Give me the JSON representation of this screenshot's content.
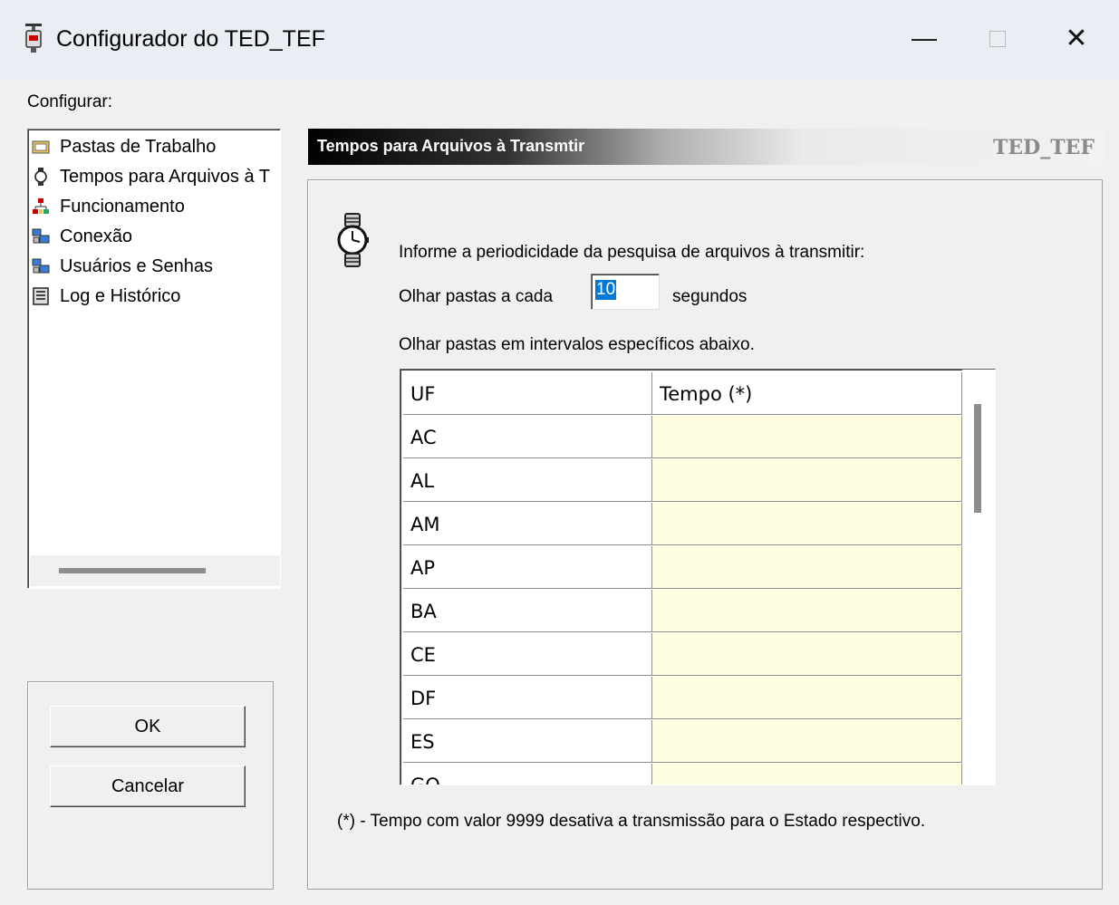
{
  "window": {
    "title": "Configurador do TED_TEF",
    "minimize": "—",
    "close": "✕"
  },
  "configure_label": "Configurar:",
  "tree": {
    "items": [
      {
        "label": "Pastas de Trabalho",
        "icon": "folder-icon"
      },
      {
        "label": "Tempos para Arquivos à T",
        "icon": "watch-icon"
      },
      {
        "label": "Funcionamento",
        "icon": "network-icon"
      },
      {
        "label": "Conexão",
        "icon": "computers-icon"
      },
      {
        "label": "Usuários e Senhas",
        "icon": "computers-icon"
      },
      {
        "label": "Log e Histórico",
        "icon": "log-icon"
      }
    ]
  },
  "buttons": {
    "ok": "OK",
    "cancel": "Cancelar"
  },
  "header": {
    "title": "Tempos para Arquivos à Transmtir",
    "app": "TED_TEF"
  },
  "panel": {
    "instruction": "Informe a periodicidade da pesquisa de arquivos à transmitir:",
    "interval_prefix": "Olhar pastas a cada",
    "interval_value": "10",
    "interval_suffix": "segundos",
    "specific_label": "Olhar pastas em intervalos específicos abaixo.",
    "footnote": "(*) - Tempo com valor 9999 desativa a transmissão para o Estado respectivo."
  },
  "grid": {
    "columns": [
      "UF",
      "Tempo (*)"
    ],
    "rows": [
      {
        "uf": "AC",
        "tempo": ""
      },
      {
        "uf": "AL",
        "tempo": ""
      },
      {
        "uf": "AM",
        "tempo": ""
      },
      {
        "uf": "AP",
        "tempo": ""
      },
      {
        "uf": "BA",
        "tempo": ""
      },
      {
        "uf": "CE",
        "tempo": ""
      },
      {
        "uf": "DF",
        "tempo": ""
      },
      {
        "uf": "ES",
        "tempo": ""
      },
      {
        "uf": "GO",
        "tempo": ""
      }
    ]
  },
  "colors": {
    "tempo_cell_bg": "#fffde0",
    "selection": "#0078d7"
  }
}
